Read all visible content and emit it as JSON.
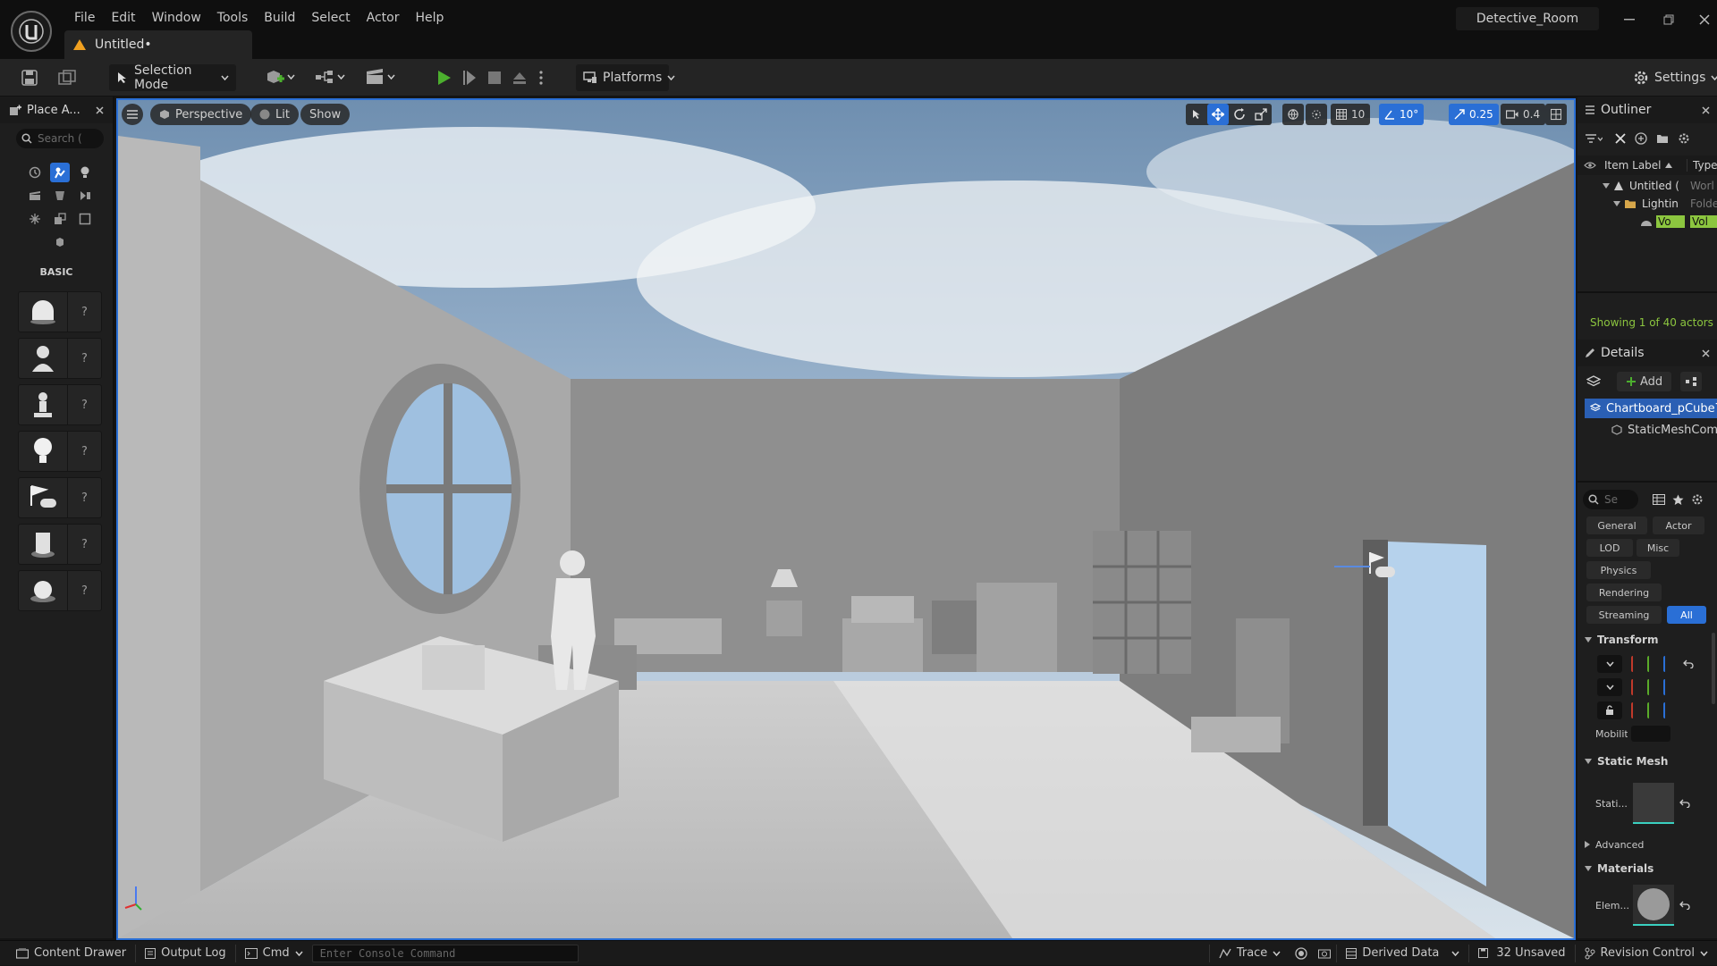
{
  "menu": [
    "File",
    "Edit",
    "Window",
    "Tools",
    "Build",
    "Select",
    "Actor",
    "Help"
  ],
  "tab": {
    "label": "Untitled•"
  },
  "project": {
    "name": "Detective_Room"
  },
  "toolbar": {
    "selection_mode": "Selection Mode",
    "platforms": "Platforms",
    "settings": "Settings"
  },
  "place_actors": {
    "title": "Place A...",
    "search_placeholder": "Search (",
    "category": "BASIC",
    "items": [
      {
        "icon": "cube-icon"
      },
      {
        "icon": "character-icon"
      },
      {
        "icon": "pawn-icon"
      },
      {
        "icon": "light-icon"
      },
      {
        "icon": "player-start-icon"
      },
      {
        "icon": "cylinder-icon"
      },
      {
        "icon": "sphere-icon"
      }
    ]
  },
  "viewport": {
    "perspective": "Perspective",
    "lit": "Lit",
    "show": "Show",
    "grid_snap": "10",
    "rotation_snap": "10°",
    "scale_snap": "0.25",
    "camera_speed": "0.4"
  },
  "outliner": {
    "title": "Outliner",
    "col_label": "Item Label",
    "col_type": "Type",
    "rows": [
      {
        "label": "Untitled (",
        "type": "Worl"
      },
      {
        "label": "Lightin",
        "type": "Folde"
      },
      {
        "label": "Vo",
        "type": "Vol"
      }
    ],
    "status": "Showing 1 of 40 actors"
  },
  "details": {
    "title": "Details",
    "add_label": "Add",
    "selected_actor": "Chartboard_pCube7",
    "component": "StaticMeshCom",
    "search_placeholder": "Se",
    "categories": [
      "General",
      "Actor",
      "LOD",
      "Misc",
      "Physics",
      "Rendering",
      "Streaming",
      "All"
    ],
    "transform_label": "Transform",
    "mobility_label": "Mobilit",
    "static_mesh_label": "Static Mesh",
    "static_mesh_prop": "Stati...",
    "advanced_label": "Advanced",
    "materials_label": "Materials",
    "element_label": "Elem..."
  },
  "statusbar": {
    "content_drawer": "Content Drawer",
    "output_log": "Output Log",
    "cmd": "Cmd",
    "console_placeholder": "Enter Console Command",
    "trace": "Trace",
    "derived_data": "Derived Data",
    "unsaved": "32 Unsaved",
    "revision_control": "Revision Control"
  },
  "colors": {
    "accent_blue": "#2a6fd6",
    "play_green": "#4caf2e",
    "outliner_status_green": "#8cc63f",
    "warning_orange": "#f0a020"
  }
}
